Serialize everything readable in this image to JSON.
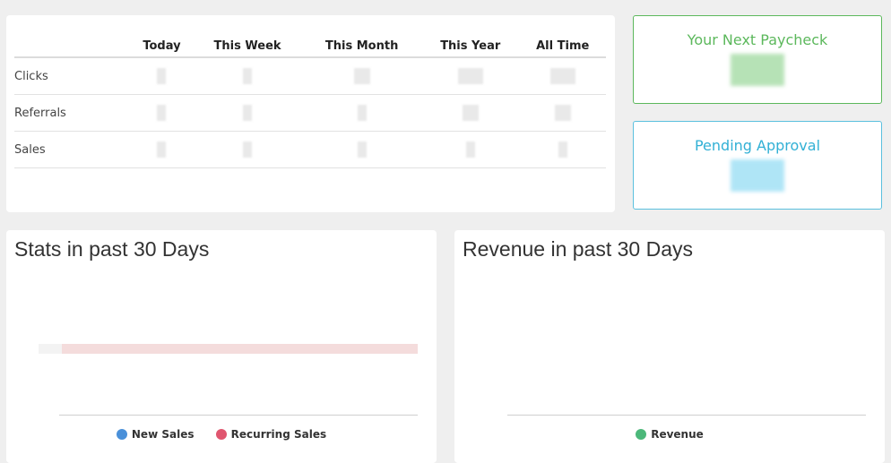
{
  "stats_table": {
    "columns": [
      "Today",
      "This Week",
      "This Month",
      "This Year",
      "All Time"
    ],
    "rows": [
      {
        "label": "Clicks"
      },
      {
        "label": "Referrals"
      },
      {
        "label": "Sales"
      }
    ]
  },
  "paycheck": {
    "title": "Your Next Paycheck"
  },
  "pending": {
    "title": "Pending Approval"
  },
  "stats_chart": {
    "title": "Stats in past 30 Days",
    "legend": [
      {
        "label": "New Sales",
        "color": "#4a90d9"
      },
      {
        "label": "Recurring Sales",
        "color": "#e0566f"
      }
    ]
  },
  "revenue_chart": {
    "title": "Revenue in past 30 Days",
    "legend": [
      {
        "label": "Revenue",
        "color": "#4cb87a"
      }
    ]
  },
  "colors": {
    "paycheck_accent": "#5cb85c",
    "pending_accent": "#5bc0de",
    "recurring_area": "#f4dcdc"
  }
}
